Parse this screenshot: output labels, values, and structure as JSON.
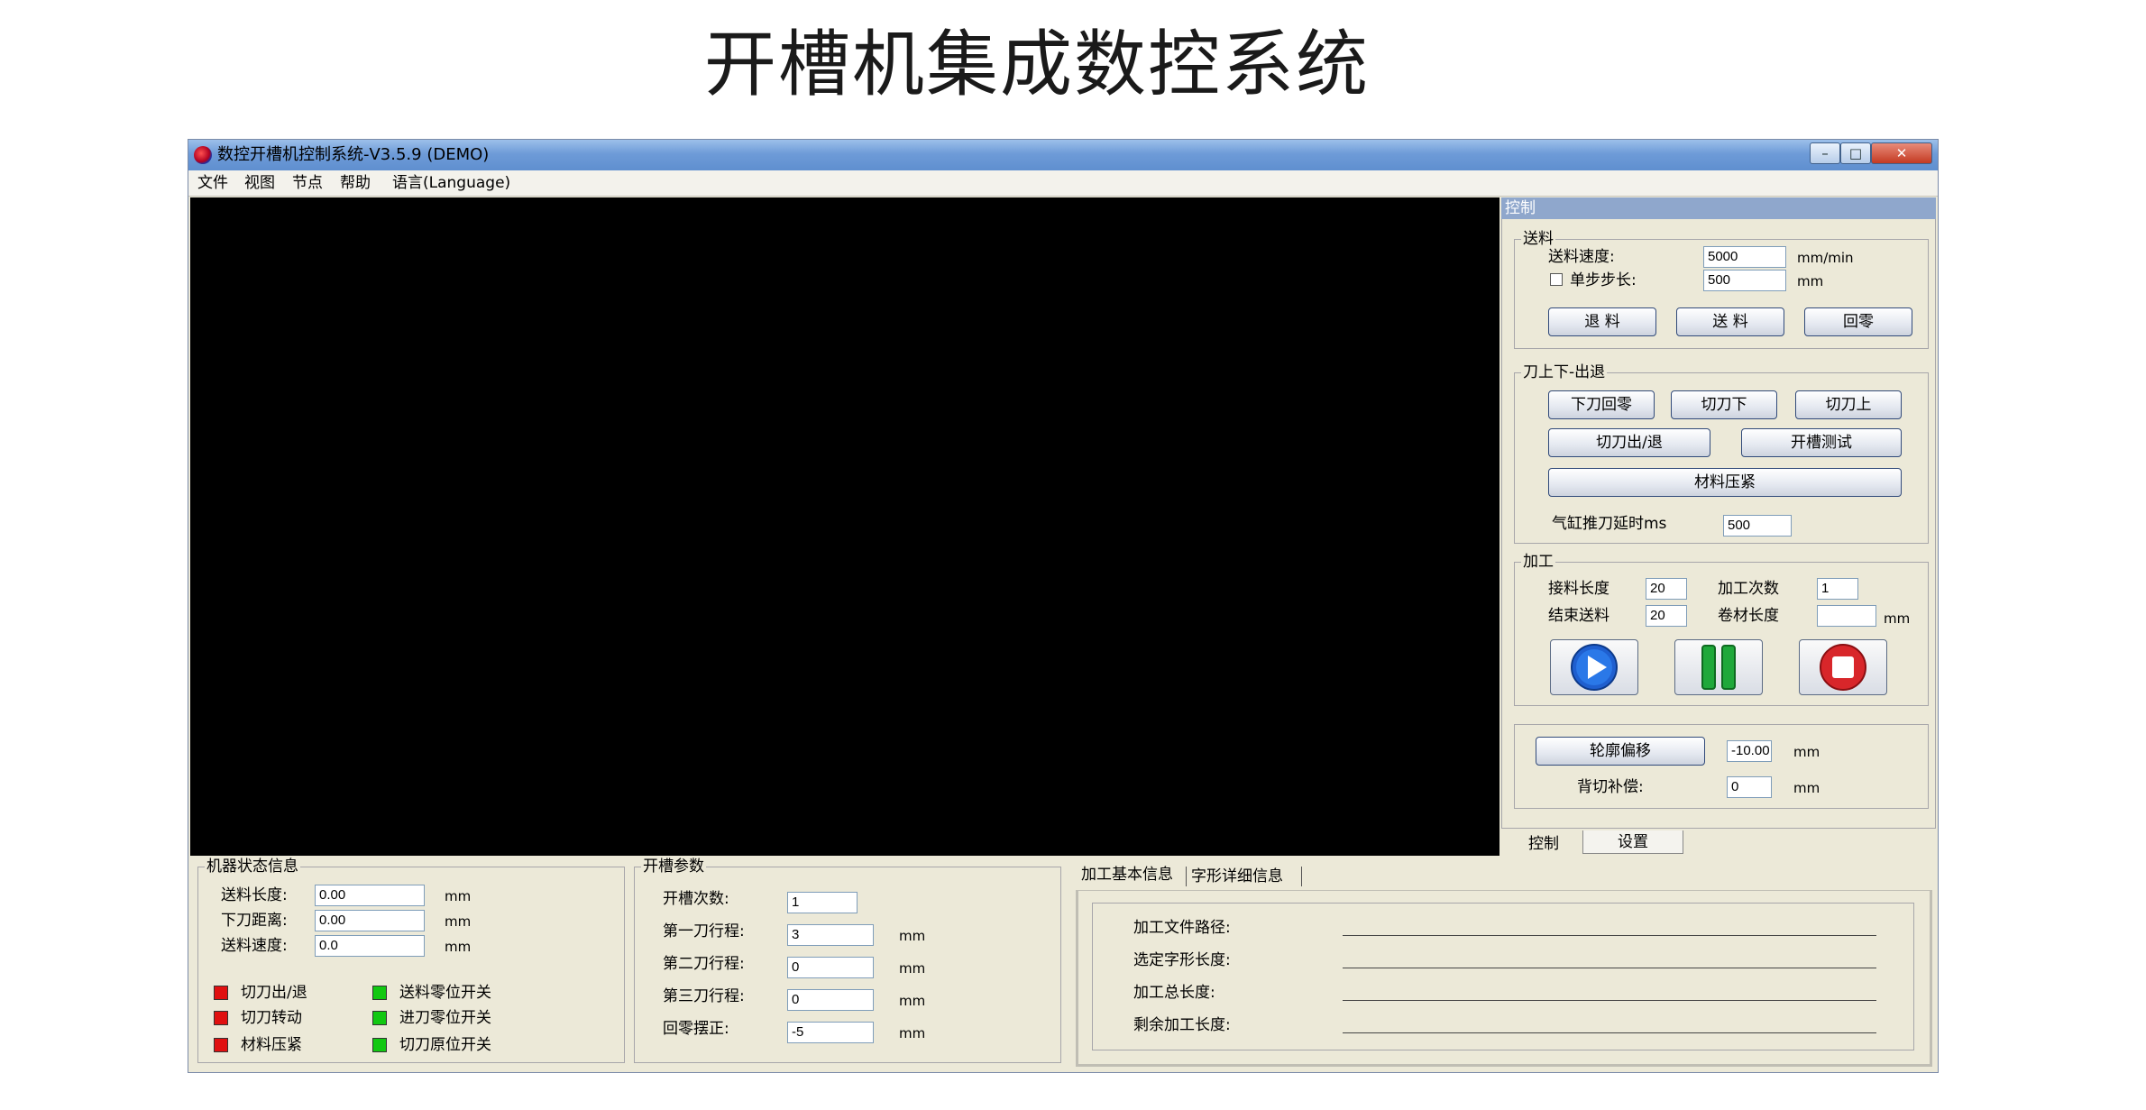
{
  "headline": "开槽机集成数控系统",
  "window": {
    "title": "数控开槽机控制系统-V3.5.9 (DEMO)",
    "buttons": {
      "minimize": "–",
      "maximize": "□",
      "close": "✕"
    }
  },
  "menu": [
    "文件",
    "视图",
    "节点",
    "帮助",
    "语言(Language)"
  ],
  "control": {
    "header": "控制",
    "feed": {
      "title": "送料",
      "speed_label": "送料速度:",
      "speed_value": "5000",
      "speed_unit": "mm/min",
      "step_label": "单步步长:",
      "step_value": "500",
      "step_unit": "mm",
      "step_checked": false,
      "buttons": [
        "退 料",
        "送 料",
        "回零"
      ]
    },
    "blade": {
      "title": "刀上下-出退",
      "row1": [
        "下刀回零",
        "切刀下",
        "切刀上"
      ],
      "row2": [
        "切刀出/退",
        "开槽测试"
      ],
      "clamp": "材料压紧",
      "delay_label": "气缸推刀延时ms",
      "delay_value": "500"
    },
    "process": {
      "title": "加工",
      "join_length_label": "接料长度",
      "join_length_value": "20",
      "count_label": "加工次数",
      "count_value": "1",
      "end_feed_label": "结束送料",
      "end_feed_value": "20",
      "coil_length_label": "卷材长度",
      "coil_length_value": "",
      "coil_unit": "mm",
      "icons": [
        "play-icon",
        "pause-icon",
        "stop-icon"
      ]
    },
    "offset": {
      "button": "轮廓偏移",
      "offset_value": "-10.00",
      "offset_unit": "mm",
      "back_cut_label": "背切补偿:",
      "back_cut_value": "0",
      "back_cut_unit": "mm"
    },
    "tabs": [
      "控制",
      "设置"
    ]
  },
  "machine_status": {
    "title": "机器状态信息",
    "rows": [
      {
        "label": "送料长度:",
        "value": "0.00",
        "unit": "mm"
      },
      {
        "label": "下刀距离:",
        "value": "0.00",
        "unit": "mm"
      },
      {
        "label": "送料速度:",
        "value": "0.0",
        "unit": "mm"
      }
    ],
    "indicators_left": [
      {
        "label": "切刀出/退",
        "color": "#e01010"
      },
      {
        "label": "切刀转动",
        "color": "#e01010"
      },
      {
        "label": "材料压紧",
        "color": "#e01010"
      }
    ],
    "indicators_right": [
      {
        "label": "送料零位开关",
        "color": "#12c812"
      },
      {
        "label": "进刀零位开关",
        "color": "#12c812"
      },
      {
        "label": "切刀原位开关",
        "color": "#12c812"
      }
    ]
  },
  "slot_params": {
    "title": "开槽参数",
    "rows": [
      {
        "label": "开槽次数:",
        "value": "1",
        "unit": ""
      },
      {
        "label": "第一刀行程:",
        "value": "3",
        "unit": "mm"
      },
      {
        "label": "第二刀行程:",
        "value": "0",
        "unit": "mm"
      },
      {
        "label": "第三刀行程:",
        "value": "0",
        "unit": "mm"
      },
      {
        "label": "回零摆正:",
        "value": "-5",
        "unit": "mm"
      }
    ]
  },
  "info": {
    "tabs": [
      "加工基本信息",
      "字形详细信息"
    ],
    "rows": [
      "加工文件路径:",
      "选定字形长度:",
      "加工总长度:",
      "剩余加工长度:"
    ]
  }
}
